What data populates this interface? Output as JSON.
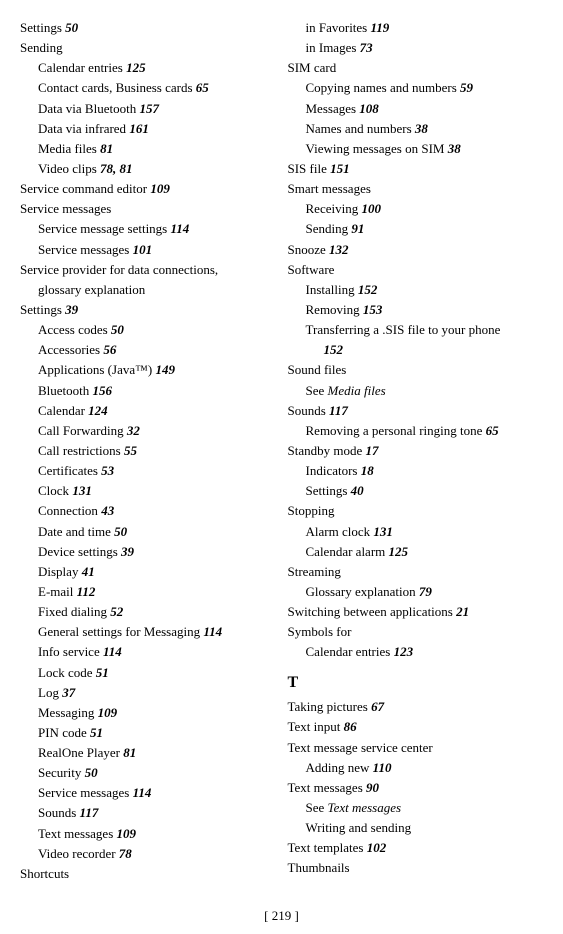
{
  "left_column": [
    {
      "text": "Settings ",
      "bold": "50",
      "indent": 0
    },
    {
      "text": "Sending",
      "bold": "",
      "indent": 0
    },
    {
      "text": "Calendar entries ",
      "bold": "125",
      "indent": 1
    },
    {
      "text": "Contact cards, Business cards ",
      "bold": "65",
      "indent": 1
    },
    {
      "text": "Data via Bluetooth ",
      "bold": "157",
      "indent": 1
    },
    {
      "text": "Data via infrared ",
      "bold": "161",
      "indent": 1
    },
    {
      "text": "Media files ",
      "bold": "81",
      "indent": 1
    },
    {
      "text": "Video clips ",
      "bold": "78, 81",
      "indent": 1
    },
    {
      "text": "Service command editor ",
      "bold": "109",
      "indent": 0
    },
    {
      "text": "Service messages",
      "bold": "",
      "indent": 0
    },
    {
      "text": "Service message settings ",
      "bold": "114",
      "indent": 1
    },
    {
      "text": "Service messages ",
      "bold": "101",
      "indent": 1
    },
    {
      "text": "Service  provider  for  data  connections,",
      "bold": "",
      "indent": 0
    },
    {
      "text": "glossary explanation",
      "bold": "",
      "indent": 1
    },
    {
      "text": "Settings ",
      "bold": "39",
      "indent": 0
    },
    {
      "text": "Access codes ",
      "bold": "50",
      "indent": 1
    },
    {
      "text": "Accessories ",
      "bold": "56",
      "indent": 1
    },
    {
      "text": "Applications (Java™) ",
      "bold": "149",
      "indent": 1
    },
    {
      "text": "Bluetooth ",
      "bold": "156",
      "indent": 1
    },
    {
      "text": "Calendar ",
      "bold": "124",
      "indent": 1
    },
    {
      "text": "Call Forwarding ",
      "bold": "32",
      "indent": 1
    },
    {
      "text": "Call restrictions ",
      "bold": "55",
      "indent": 1
    },
    {
      "text": "Certificates ",
      "bold": "53",
      "indent": 1
    },
    {
      "text": "Clock ",
      "bold": "131",
      "indent": 1
    },
    {
      "text": "Connection ",
      "bold": "43",
      "indent": 1
    },
    {
      "text": "Date and time ",
      "bold": "50",
      "indent": 1
    },
    {
      "text": "Device settings ",
      "bold": "39",
      "indent": 1
    },
    {
      "text": "Display ",
      "bold": "41",
      "indent": 1
    },
    {
      "text": "E-mail ",
      "bold": "112",
      "indent": 1
    },
    {
      "text": "Fixed dialing ",
      "bold": "52",
      "indent": 1
    },
    {
      "text": "General settings for Messaging ",
      "bold": "114",
      "indent": 1
    },
    {
      "text": "Info service ",
      "bold": "114",
      "indent": 1
    },
    {
      "text": "Lock code ",
      "bold": "51",
      "indent": 1
    },
    {
      "text": "Log ",
      "bold": "37",
      "indent": 1
    },
    {
      "text": "Messaging ",
      "bold": "109",
      "indent": 1
    },
    {
      "text": "PIN code ",
      "bold": "51",
      "indent": 1
    },
    {
      "text": "RealOne Player ",
      "bold": "81",
      "indent": 1
    },
    {
      "text": "Security ",
      "bold": "50",
      "indent": 1
    },
    {
      "text": "Service messages ",
      "bold": "114",
      "indent": 1
    },
    {
      "text": "Sounds ",
      "bold": "117",
      "indent": 1
    },
    {
      "text": "Text messages ",
      "bold": "109",
      "indent": 1
    },
    {
      "text": "Video recorder ",
      "bold": "78",
      "indent": 1
    },
    {
      "text": "Shortcuts",
      "bold": "",
      "indent": 0
    }
  ],
  "right_column": [
    {
      "text": "in Favorites ",
      "bold": "119",
      "indent": 1
    },
    {
      "text": "in Images ",
      "bold": "73",
      "indent": 1
    },
    {
      "text": "SIM card",
      "bold": "",
      "indent": 0
    },
    {
      "text": "Copying names and numbers ",
      "bold": "59",
      "indent": 1
    },
    {
      "text": "Messages ",
      "bold": "108",
      "indent": 1
    },
    {
      "text": "Names and numbers ",
      "bold": "38",
      "indent": 1
    },
    {
      "text": "Viewing messages on SIM ",
      "bold": "38",
      "indent": 1
    },
    {
      "text": "SIS file ",
      "bold": "151",
      "indent": 0
    },
    {
      "text": "Smart messages",
      "bold": "",
      "indent": 0
    },
    {
      "text": "Receiving ",
      "bold": "100",
      "indent": 1
    },
    {
      "text": "Sending ",
      "bold": "91",
      "indent": 1
    },
    {
      "text": "Snooze ",
      "bold": "132",
      "indent": 0
    },
    {
      "text": "Software",
      "bold": "",
      "indent": 0
    },
    {
      "text": "Installing ",
      "bold": "152",
      "indent": 1
    },
    {
      "text": "Removing ",
      "bold": "153",
      "indent": 1
    },
    {
      "text": "Transferring a .SIS file to your phone",
      "bold": "",
      "indent": 1
    },
    {
      "text": "152",
      "bold": "152",
      "indent": 2,
      "bold_only": true
    },
    {
      "text": "Sound files",
      "bold": "",
      "indent": 0
    },
    {
      "text": "See ",
      "bold": "",
      "indent": 1,
      "italic_after": "Media files"
    },
    {
      "text": "Sounds ",
      "bold": "117",
      "indent": 0
    },
    {
      "text": "Removing a personal ringing tone ",
      "bold": "65",
      "indent": 1
    },
    {
      "text": "Standby mode ",
      "bold": "17",
      "indent": 0
    },
    {
      "text": "Indicators ",
      "bold": "18",
      "indent": 1
    },
    {
      "text": "Settings ",
      "bold": "40",
      "indent": 1
    },
    {
      "text": "Stopping",
      "bold": "",
      "indent": 0
    },
    {
      "text": "Alarm clock ",
      "bold": "131",
      "indent": 1
    },
    {
      "text": "Calendar alarm ",
      "bold": "125",
      "indent": 1
    },
    {
      "text": "Streaming",
      "bold": "",
      "indent": 0
    },
    {
      "text": "Glossary explanation ",
      "bold": "79",
      "indent": 1
    },
    {
      "text": "Switching between applications ",
      "bold": "21",
      "indent": 0
    },
    {
      "text": "Symbols for",
      "bold": "",
      "indent": 0
    },
    {
      "text": "Calendar entries ",
      "bold": "123",
      "indent": 1
    },
    {
      "text": "T",
      "bold": "",
      "indent": 0,
      "section": true
    },
    {
      "text": "Taking pictures ",
      "bold": "67",
      "indent": 0
    },
    {
      "text": "Text input ",
      "bold": "86",
      "indent": 0
    },
    {
      "text": "Text message service center",
      "bold": "",
      "indent": 0
    },
    {
      "text": "Adding new ",
      "bold": "110",
      "indent": 1
    },
    {
      "text": "Text messages ",
      "bold": "90",
      "indent": 0
    },
    {
      "text": "See ",
      "bold": "",
      "indent": 1,
      "italic_after": "Text messages"
    },
    {
      "text": "Writing and sending",
      "bold": "",
      "indent": 1
    },
    {
      "text": "Text templates ",
      "bold": "102",
      "indent": 0
    },
    {
      "text": "Thumbnails",
      "bold": "",
      "indent": 0
    }
  ],
  "footer": {
    "text": "[ 219 ]"
  }
}
